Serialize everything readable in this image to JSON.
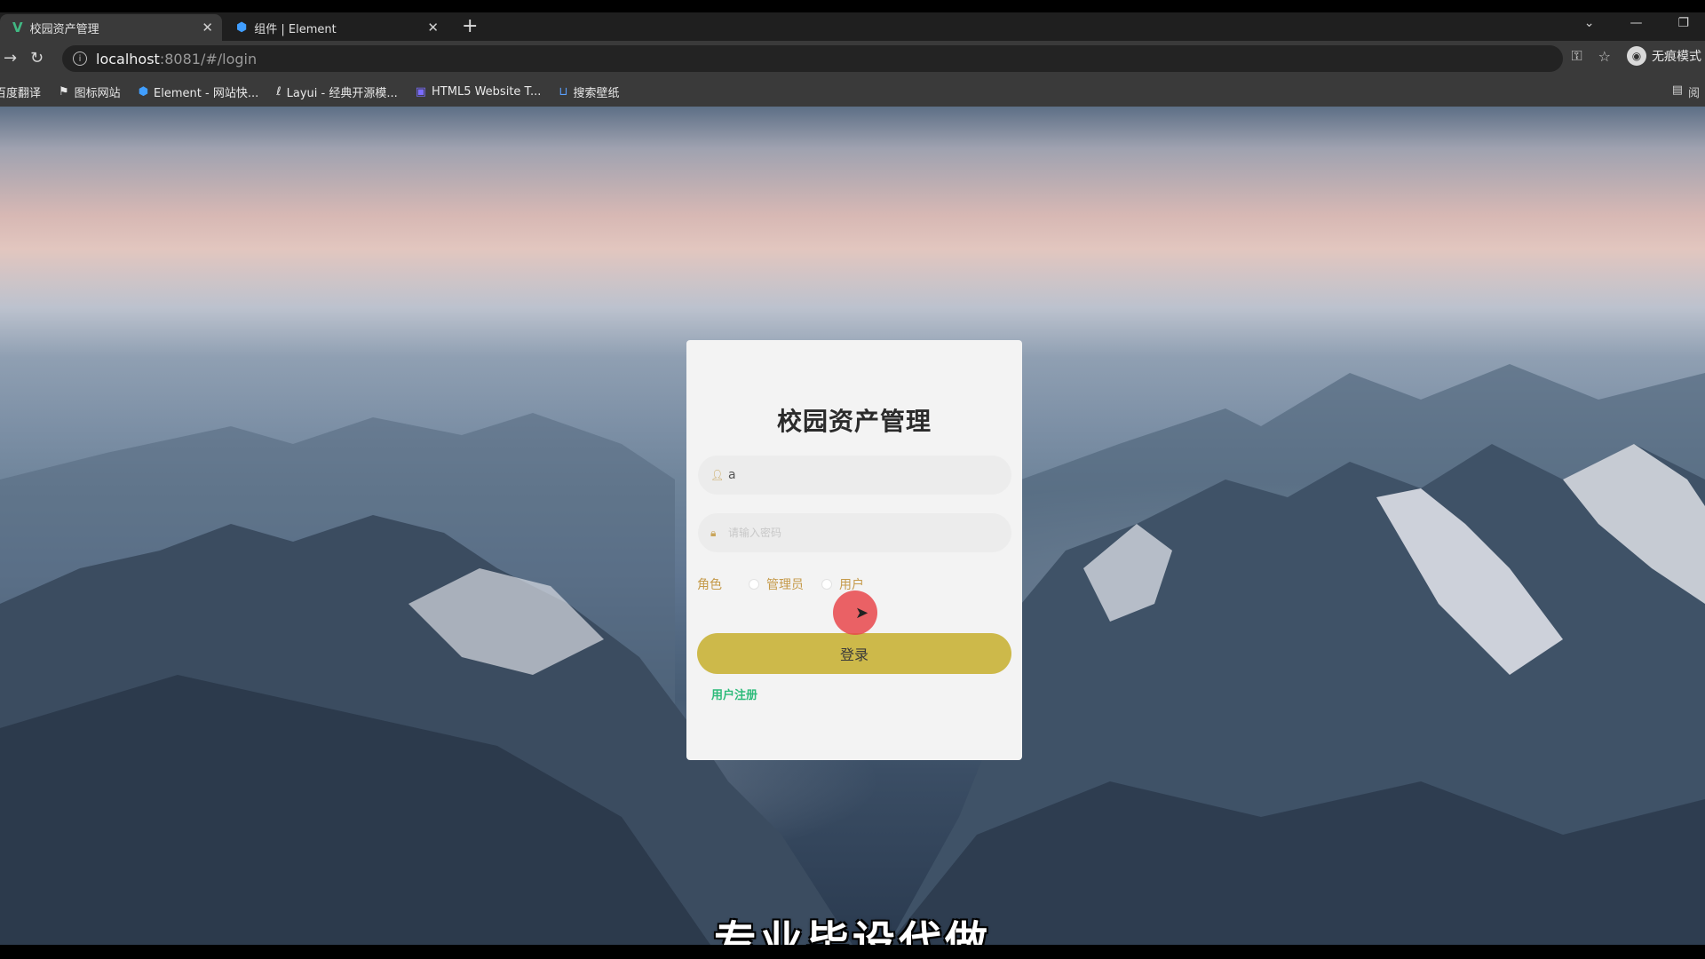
{
  "browser": {
    "tabs": [
      {
        "title": "校园资产管理",
        "icon": "vue-logo-icon",
        "active": true
      },
      {
        "title": "组件 | Element",
        "icon": "element-logo-icon",
        "active": false
      }
    ],
    "new_tab_label": "+",
    "url": {
      "host": "localhost",
      "rest": ":8081/#/login"
    },
    "profile_label": "无痕模式",
    "bookmarks": [
      {
        "label": "百度翻译",
        "icon": "translate-icon"
      },
      {
        "label": "图标网站",
        "icon": "flag-icon"
      },
      {
        "label": "Element - 网站快...",
        "icon": "element-logo-icon"
      },
      {
        "label": "Layui - 经典开源模...",
        "icon": "layui-logo-icon"
      },
      {
        "label": "HTML5 Website T...",
        "icon": "html5-template-icon"
      },
      {
        "label": "搜索壁纸",
        "icon": "wallpaper-icon"
      }
    ],
    "reading_list_label": "阅"
  },
  "login": {
    "title": "校园资产管理",
    "username_value": "a",
    "password_placeholder": "请输入密码",
    "role_label": "角色",
    "role_options": [
      "管理员",
      "用户"
    ],
    "login_button": "登录",
    "register_link": "用户注册"
  },
  "overlay": {
    "subtitle": "专业毕设代做"
  },
  "colors": {
    "card_bg": "#f3f3f3",
    "login_button": "#cdb94a",
    "role_text": "#c59a4a",
    "register_link": "#2dbb7a"
  }
}
